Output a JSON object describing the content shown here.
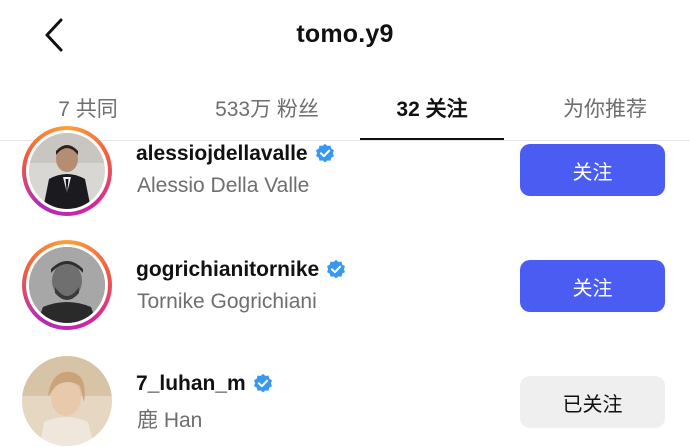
{
  "header": {
    "title": "tomo.y9",
    "back_icon": "chevron-left-icon"
  },
  "tabs": [
    {
      "label": "7 共同",
      "active": false
    },
    {
      "label": "533万 粉丝",
      "active": false
    },
    {
      "label": "32 关注",
      "active": true
    },
    {
      "label": "为你推荐",
      "active": false
    }
  ],
  "users": [
    {
      "username": "alessiojdellavalle",
      "full_name": "Alessio Della Valle",
      "verified": true,
      "has_story_ring": true,
      "button_label": "关注",
      "button_state": "follow"
    },
    {
      "username": "gogrichianitornike",
      "full_name": "Tornike Gogrichiani",
      "verified": true,
      "has_story_ring": true,
      "button_label": "关注",
      "button_state": "follow"
    },
    {
      "username": "7_luhan_m",
      "full_name": "鹿 Han",
      "verified": true,
      "has_story_ring": false,
      "button_label": "已关注",
      "button_state": "following"
    }
  ],
  "colors": {
    "follow_button": "#4a5cf2",
    "following_button": "#efefef",
    "verified_badge": "#3897f0",
    "secondary_text": "#6e6e6e"
  }
}
